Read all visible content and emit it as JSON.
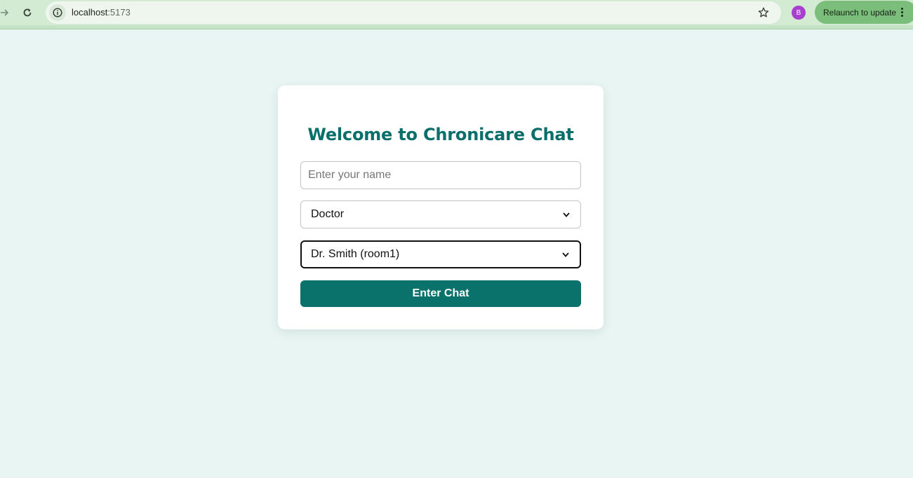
{
  "browser": {
    "url_host": "localhost",
    "url_port": ":5173",
    "profile_initial": "B",
    "relaunch_label": "Relaunch to update",
    "icons": {
      "forward": "arrow-right-icon",
      "reload": "reload-icon",
      "site_info": "info-icon",
      "bookmark": "star-icon",
      "menu": "kebab-menu-icon"
    },
    "colors": {
      "toolbar": "#d3ead3",
      "omnibox": "#eef6ee",
      "avatar": "#a93fd1",
      "relaunch": "#7bbd7b"
    }
  },
  "login": {
    "title": "Welcome to Chronicare Chat",
    "name_input": {
      "placeholder": "Enter your name",
      "value": ""
    },
    "role_select": {
      "selected": "Doctor"
    },
    "doctor_select": {
      "selected": "Dr. Smith (room1)"
    },
    "enter_label": "Enter Chat",
    "colors": {
      "page_bg": "#e8f5f3",
      "accent": "#0a716b",
      "title": "#0a6e6a"
    }
  }
}
